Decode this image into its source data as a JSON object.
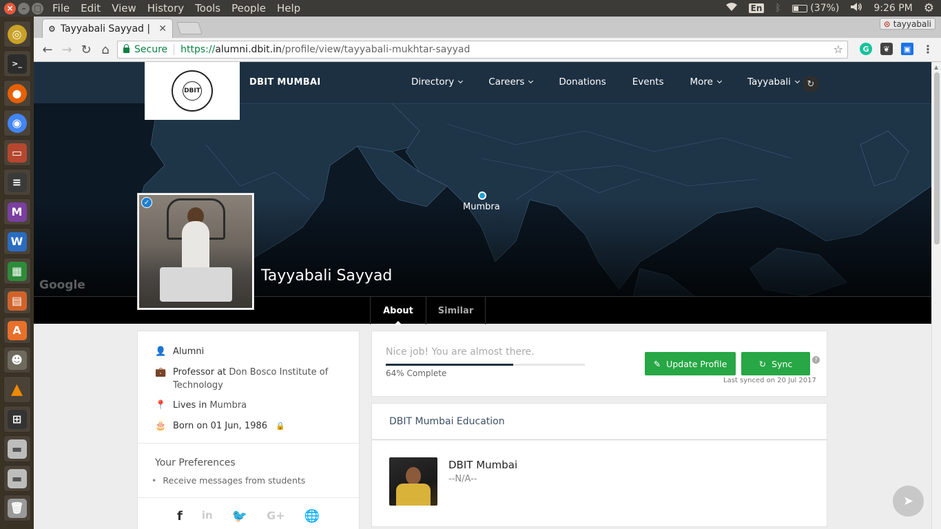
{
  "os": {
    "menu": [
      "File",
      "Edit",
      "View",
      "History",
      "Tools",
      "People",
      "Help"
    ],
    "tray": {
      "lang": "En",
      "battery": "(37%)",
      "clock": "9:26 PM"
    }
  },
  "browser": {
    "tab_title": "Tayyabali Sayyad | D",
    "profile_chip": "tayyabali",
    "secure_label": "Secure",
    "url_scheme": "https://",
    "url_host": "alumni.dbit.in",
    "url_path": "/profile/view/tayyabali-mukhtar-sayyad"
  },
  "site": {
    "brand": "DBIT MUMBAI",
    "logo_text": "DBIT",
    "logo_ring_text": "TECHNOLOGY FOR THE YOUNG",
    "nav": [
      {
        "label": "Directory",
        "dropdown": true
      },
      {
        "label": "Careers",
        "dropdown": true
      },
      {
        "label": "Donations",
        "dropdown": false
      },
      {
        "label": "Events",
        "dropdown": false
      },
      {
        "label": "More",
        "dropdown": true
      },
      {
        "label": "Tayyabali",
        "dropdown": true
      }
    ]
  },
  "hero": {
    "location": "Mumbra",
    "map_brand": "Google",
    "name": "Tayyabali Sayyad"
  },
  "profile_tabs": [
    "About",
    "Similar"
  ],
  "about": {
    "type": "Alumni",
    "job_title": "Professor",
    "at": "at",
    "employer": "Don Bosco Institute of Technology",
    "lives_prefix": "Lives in",
    "city": "Mumbra",
    "born": "Born on 01 Jun, 1986",
    "preferences_title": "Your Preferences",
    "preference": "Receive messages from students"
  },
  "progress": {
    "message": "Nice job! You are almost there.",
    "fraction": 0.64,
    "label": "64% Complete",
    "update_button": "Update Profile",
    "sync_button": "Sync",
    "last_synced": "Last synced on 20 Jul 2017"
  },
  "education": {
    "title": "DBIT Mumbai Education",
    "school": "DBIT Mumbai",
    "detail": "--N/A--"
  },
  "colors": {
    "nav_bg": "#1d3042",
    "accent_green": "#27a745",
    "secure_green": "#0b8043"
  }
}
